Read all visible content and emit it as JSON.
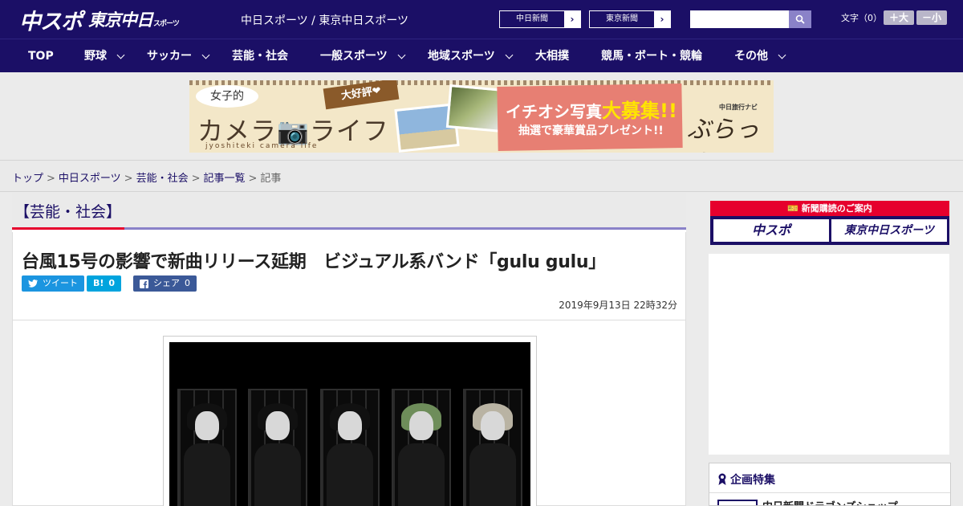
{
  "header": {
    "logo_main": "中スポ",
    "logo_tokyo": "東京中日",
    "logo_tokyo_small": "スポーツ",
    "site_name": "中日スポーツ / 東京中日スポーツ",
    "paper_links": [
      "中日新聞",
      "東京新聞"
    ],
    "search_placeholder": "",
    "font_size_label": "文字（0）",
    "font_bigger": "＋大",
    "font_smaller": "－小"
  },
  "nav": {
    "items": [
      {
        "label": "TOP",
        "has_menu": false
      },
      {
        "label": "野球",
        "has_menu": true
      },
      {
        "label": "サッカー",
        "has_menu": true
      },
      {
        "label": "芸能・社会",
        "has_menu": false
      },
      {
        "label": "一般スポーツ",
        "has_menu": true
      },
      {
        "label": "地域スポーツ",
        "has_menu": true
      },
      {
        "label": "大相撲",
        "has_menu": false
      },
      {
        "label": "競馬・ボート・競輪",
        "has_menu": false
      },
      {
        "label": "その他",
        "has_menu": true
      }
    ]
  },
  "banner": {
    "bubble": "女子的",
    "title": "カメラ📷ライフ",
    "subtitle": "jyoshiteki camera life",
    "ribbon": "大好評❤",
    "promo_line1_a": "イチオシ写真",
    "promo_line1_b": "大募集!!",
    "promo_line2": "抽選で豪華賞品プレゼント!!",
    "brand_small": "中日旅行ナビ",
    "brand": "ぶらっ人"
  },
  "breadcrumb": {
    "items": [
      "トップ",
      "中日スポーツ",
      "芸能・社会",
      "記事一覧"
    ],
    "current": "記事",
    "separator": ">"
  },
  "article": {
    "category": "【芸能・社会】",
    "headline": "台風15号の影響で新曲リリース延期　ビジュアル系バンド「gulu gulu」",
    "share": {
      "tweet": "ツイート",
      "hatena": "B!",
      "hatena_count": "0",
      "facebook": "シェア",
      "facebook_count": "0"
    },
    "date": "2019年9月13日 22時32分"
  },
  "sidebar": {
    "subscribe_header": "新聞購読のご案内",
    "subscribe_buttons": [
      "中スポ",
      "東京中日スポーツ"
    ],
    "feature_title": "企画特集",
    "feature_item": "中日新聞ドラゴンズショップ"
  },
  "colors": {
    "brand_navy": "#1b0f66",
    "accent_red": "#e6002d",
    "accent_lavender": "#8a82c8"
  }
}
